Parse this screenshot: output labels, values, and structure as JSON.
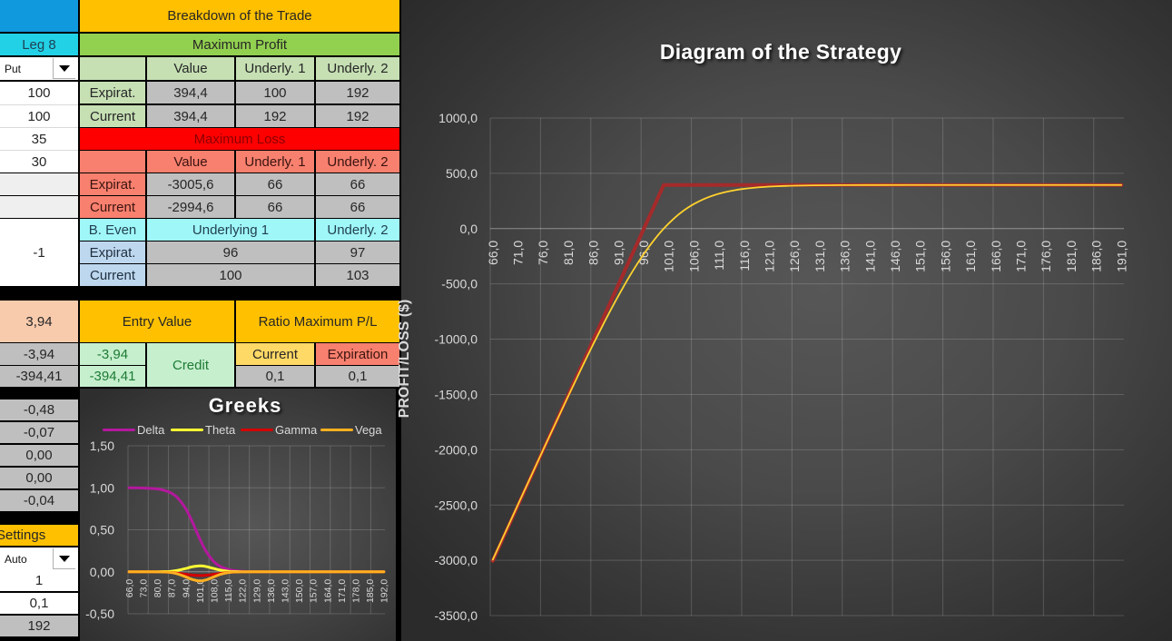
{
  "table": {
    "header": {
      "title": "Breakdown of the Trade"
    },
    "leg": {
      "label": "Leg 8",
      "type_select": "Put",
      "inputs": [
        "100",
        "100",
        "35",
        "30"
      ],
      "result": "-1"
    },
    "max_profit": {
      "title": "Maximum Profit",
      "columns": [
        "Value",
        "Underly. 1",
        "Underly. 2"
      ],
      "rows": [
        {
          "label": "Expirat.",
          "values": [
            "394,4",
            "100",
            "192"
          ]
        },
        {
          "label": "Current",
          "values": [
            "394,4",
            "192",
            "192"
          ]
        }
      ]
    },
    "max_loss": {
      "title": "Maximum Loss",
      "columns": [
        "Value",
        "Underly. 1",
        "Underly. 2"
      ],
      "rows": [
        {
          "label": "Expirat.",
          "values": [
            "-3005,6",
            "66",
            "66"
          ]
        },
        {
          "label": "Current",
          "values": [
            "-2994,6",
            "66",
            "66"
          ]
        }
      ]
    },
    "break_even": {
      "title": "B. Even",
      "columns": [
        "Underlying 1",
        "Underly. 2"
      ],
      "rows": [
        {
          "label": "Expirat.",
          "values": [
            "96",
            "97"
          ]
        },
        {
          "label": "Current",
          "values": [
            "100",
            "103"
          ]
        }
      ]
    },
    "entry": {
      "premium": "3,94",
      "title": "Entry Value",
      "left_values": [
        "-3,94",
        "-394,41"
      ],
      "values": [
        "-3,94",
        "-394,41"
      ],
      "type": "Credit"
    },
    "ratio": {
      "title": "Ratio Maximum P/L",
      "columns": [
        "Current",
        "Expiration"
      ],
      "values": [
        "0,1",
        "0,1"
      ]
    },
    "greek_values": [
      "-0,48",
      "-0,07",
      "0,00",
      "0,00",
      "-0,04"
    ],
    "settings": {
      "title": "Settings",
      "mode_select": "Auto",
      "values": [
        "1",
        "0,1",
        "192"
      ]
    }
  },
  "chart_data": [
    {
      "type": "line",
      "title": "Diagram of the Strategy",
      "xlabel": "",
      "ylabel": "PROFIT/LOSS ($)",
      "x_min": 66,
      "x_max": 191,
      "x_tick_step": 5,
      "x_grid_step": 10,
      "x_tick_labels": [
        "66,0",
        "71,0",
        "76,0",
        "81,0",
        "86,0",
        "91,0",
        "96,0",
        "101,0",
        "106,0",
        "111,0",
        "116,0",
        "121,0",
        "126,0",
        "131,0",
        "136,0",
        "141,0",
        "146,0",
        "151,0",
        "156,0",
        "161,0",
        "166,0",
        "171,0",
        "176,0",
        "181,0",
        "186,0",
        "191,0"
      ],
      "ylim": [
        -3500,
        1000
      ],
      "y_ticks": [
        {
          "value": 1000,
          "label": "1000,0"
        },
        {
          "value": 500,
          "label": "500,0"
        },
        {
          "value": 0,
          "label": "0,0"
        },
        {
          "value": -500,
          "label": "-500,0"
        },
        {
          "value": -1000,
          "label": "-1000,0"
        },
        {
          "value": -1500,
          "label": "-1500,0"
        },
        {
          "value": -2000,
          "label": "-2000,0"
        },
        {
          "value": -2500,
          "label": "-2500,0"
        },
        {
          "value": -3000,
          "label": "-3000,0"
        },
        {
          "value": -3500,
          "label": "-3500,0"
        }
      ],
      "grid": true,
      "legend": "none",
      "series": [
        {
          "key": "expiration",
          "color": "#a52a2a",
          "smooth": false,
          "points": [
            [
              66,
              -3005.6
            ],
            [
              100,
              394.4
            ],
            [
              191,
              394.4
            ]
          ]
        },
        {
          "key": "current",
          "color": "#ffd22e",
          "smooth": true,
          "points": [
            [
              66,
              -2994.6
            ],
            [
              71,
              -2498.3
            ],
            [
              76,
              -2003.7
            ],
            [
              81,
              -1516.2
            ],
            [
              84,
              -1230.0
            ],
            [
              86,
              -1044.1
            ],
            [
              88,
              -863.6
            ],
            [
              90,
              -690.2
            ],
            [
              92,
              -525.5
            ],
            [
              94,
              -372.0
            ],
            [
              96,
              -232.1
            ],
            [
              98,
              -107.7
            ],
            [
              100,
              0.0
            ],
            [
              102,
              90.4
            ],
            [
              104,
              164.1
            ],
            [
              106,
              222.5
            ],
            [
              108,
              267.9
            ],
            [
              110,
              302.1
            ],
            [
              112,
              327.7
            ],
            [
              114,
              346.4
            ],
            [
              116,
              360.1
            ],
            [
              118,
              369.9
            ],
            [
              120,
              377.0
            ],
            [
              122,
              382.0
            ],
            [
              124,
              385.6
            ],
            [
              126,
              388.2
            ],
            [
              130,
              391.3
            ],
            [
              135,
              393.1
            ],
            [
              140,
              393.9
            ],
            [
              150,
              394.3
            ],
            [
              191,
              394.4
            ]
          ]
        }
      ]
    },
    {
      "type": "line",
      "title": "Greeks",
      "xlabel": "",
      "ylabel": "",
      "x_min": 66,
      "x_max": 192,
      "x_tick_step": 7,
      "x_grid_step": 10,
      "x_tick_labels": [
        "66,0",
        "73,0",
        "80,0",
        "87,0",
        "94,0",
        "101,0",
        "108,0",
        "115,0",
        "122,0",
        "129,0",
        "136,0",
        "143,0",
        "150,0",
        "157,0",
        "164,0",
        "171,0",
        "178,0",
        "185,0",
        "192,0"
      ],
      "ylim": [
        -0.5,
        1.5
      ],
      "y_ticks": [
        {
          "value": 1.5,
          "label": "1,50"
        },
        {
          "value": 1.0,
          "label": "1,00"
        },
        {
          "value": 0.5,
          "label": "0,50"
        },
        {
          "value": 0,
          "label": "0,00"
        },
        {
          "value": -0.5,
          "label": "-0,50"
        }
      ],
      "grid": true,
      "legend": "top",
      "x": [
        66,
        73,
        80,
        84,
        87,
        90,
        94,
        97,
        101,
        104,
        108,
        111,
        115,
        118,
        122,
        129,
        136,
        192
      ],
      "series": [
        {
          "name": "Delta",
          "color": "#b4189e",
          "smooth": true,
          "values": [
            1.0,
            0.997,
            0.986,
            0.966,
            0.935,
            0.881,
            0.752,
            0.609,
            0.391,
            0.248,
            0.119,
            0.065,
            0.028,
            0.015,
            0.006,
            0.001,
            0,
            0
          ]
        },
        {
          "name": "Theta",
          "color": "#ffff33",
          "smooth": true,
          "values": [
            0,
            0,
            0,
            0.002,
            0.006,
            0.016,
            0.038,
            0.058,
            0.07,
            0.063,
            0.038,
            0.02,
            0.006,
            0.002,
            0,
            0,
            0,
            0
          ]
        },
        {
          "name": "Gamma",
          "color": "#d40000",
          "smooth": true,
          "values": [
            0,
            0,
            -0.001,
            -0.004,
            -0.009,
            -0.017,
            -0.03,
            -0.039,
            -0.045,
            -0.042,
            -0.03,
            -0.02,
            -0.009,
            -0.004,
            -0.001,
            0,
            0,
            0
          ]
        },
        {
          "name": "Vega",
          "color": "#ffb020",
          "smooth": true,
          "values": [
            0,
            0,
            -0.001,
            -0.003,
            -0.01,
            -0.025,
            -0.06,
            -0.09,
            -0.11,
            -0.098,
            -0.06,
            -0.032,
            -0.01,
            -0.003,
            -0.001,
            0,
            0,
            0
          ]
        }
      ]
    }
  ]
}
